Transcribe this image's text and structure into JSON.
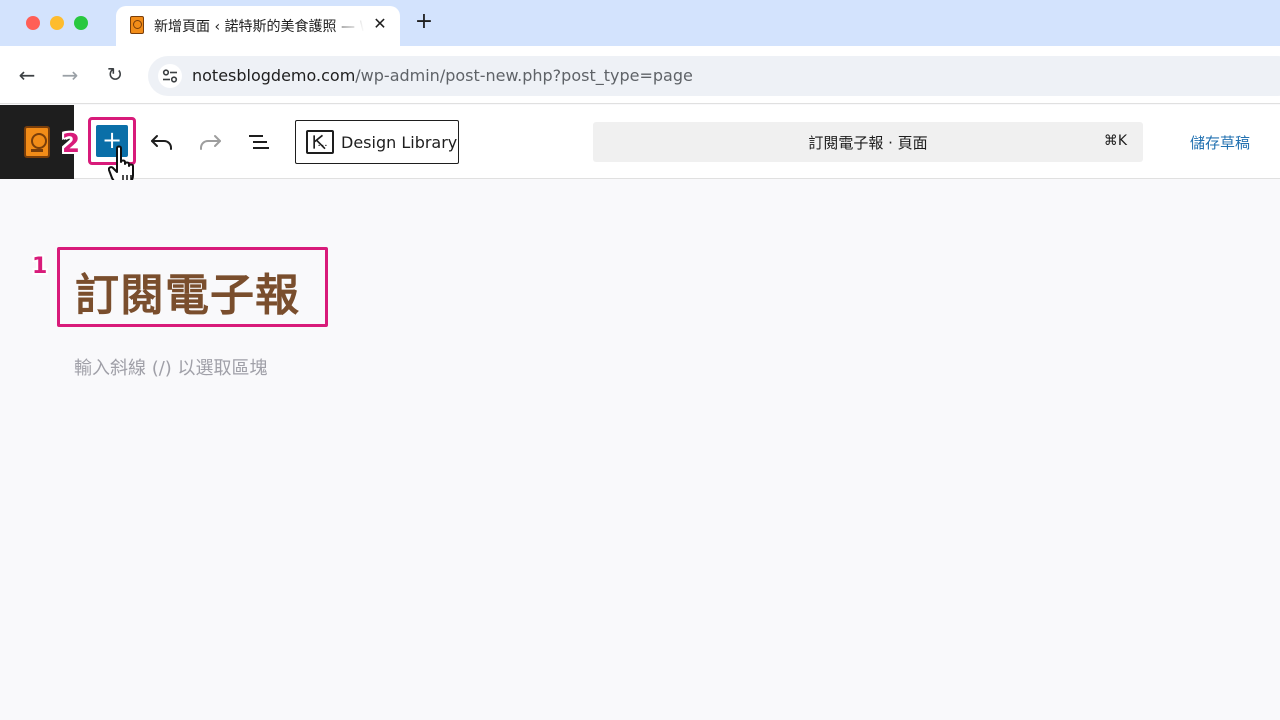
{
  "browser": {
    "tab": {
      "title": "新增頁面 ‹ 諾特斯的美食護照 — WordPress",
      "favicon": "passport-icon",
      "close_glyph": "✕"
    },
    "new_tab_glyph": "+",
    "nav": {
      "back_glyph": "←",
      "forward_glyph": "→",
      "reload_glyph": "↻"
    },
    "url": {
      "host": "notesblogdemo.com",
      "path": "/wp-admin/post-new.php?post_type=page"
    }
  },
  "editor": {
    "toolbar": {
      "inserter_label": "+",
      "design_library_label": "Design Library",
      "command_bar_title": "訂閱電子報 · 頁面",
      "command_bar_shortcut": "⌘K",
      "save_draft_label": "儲存草稿"
    },
    "annotations": {
      "step_1": "1",
      "step_2": "2"
    },
    "content": {
      "title": "訂閱電子報",
      "block_placeholder": "輸入斜線 (/) 以選取區塊"
    },
    "colors": {
      "accent": "#0a6fa8",
      "highlight": "#d81b7a",
      "title_text": "#7a4e2d",
      "link": "#2271b1"
    }
  }
}
